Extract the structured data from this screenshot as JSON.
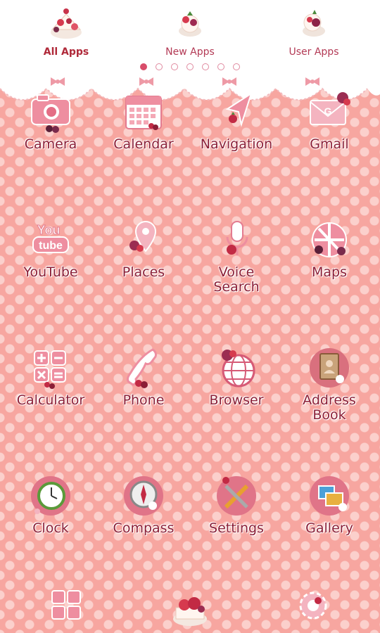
{
  "tabs": [
    {
      "label": "All Apps",
      "active": true
    },
    {
      "label": "New Apps",
      "active": false
    },
    {
      "label": "User Apps",
      "active": false
    }
  ],
  "pager": {
    "count": 7,
    "active_index": 0
  },
  "apps": [
    {
      "label": "Camera",
      "icon": "camera-icon"
    },
    {
      "label": "Calendar",
      "icon": "calendar-icon"
    },
    {
      "label": "Navigation",
      "icon": "navigation-icon"
    },
    {
      "label": "Gmail",
      "icon": "gmail-icon"
    },
    {
      "label": "YouTube",
      "icon": "youtube-icon"
    },
    {
      "label": "Places",
      "icon": "places-icon"
    },
    {
      "label": "Voice\nSearch",
      "icon": "microphone-icon"
    },
    {
      "label": "Maps",
      "icon": "maps-icon"
    },
    {
      "label": "Calculator",
      "icon": "calculator-icon"
    },
    {
      "label": "Phone",
      "icon": "phone-icon"
    },
    {
      "label": "Browser",
      "icon": "globe-icon"
    },
    {
      "label": "Address\nBook",
      "icon": "address-book-icon"
    },
    {
      "label": "Clock",
      "icon": "clock-icon"
    },
    {
      "label": "Compass",
      "icon": "compass-icon"
    },
    {
      "label": "Settings",
      "icon": "settings-tools-icon"
    },
    {
      "label": "Gallery",
      "icon": "gallery-icon"
    }
  ],
  "icon_text": {
    "youtube_top": "You",
    "youtube_bottom": "tube",
    "gmail_letter": "G"
  },
  "dock": [
    {
      "icon": "app-drawer-icon"
    },
    {
      "icon": "cake-home-icon"
    },
    {
      "icon": "settings-gear-icon"
    }
  ],
  "colors": {
    "wallpaper": "#f7a6a0",
    "polka_dot": "#fbd0cc",
    "label_text": "#8b1e36",
    "accent": "#d84d6a"
  }
}
